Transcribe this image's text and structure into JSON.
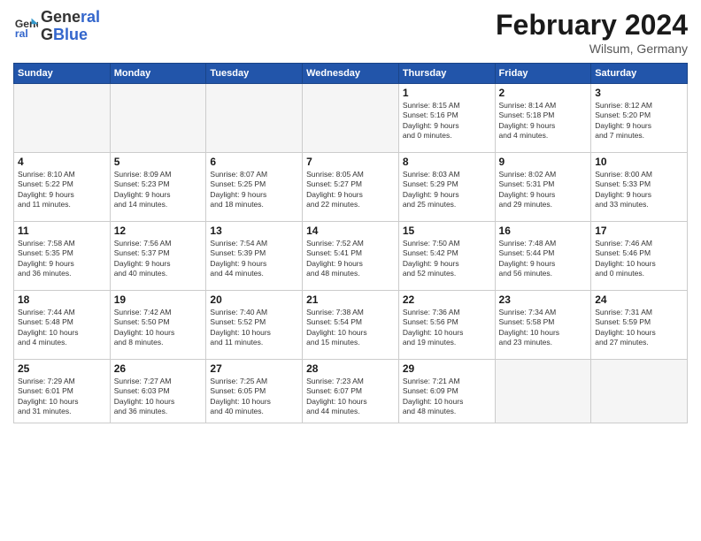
{
  "header": {
    "logo_line1": "General",
    "logo_line2": "Blue",
    "month_title": "February 2024",
    "location": "Wilsum, Germany"
  },
  "days_of_week": [
    "Sunday",
    "Monday",
    "Tuesday",
    "Wednesday",
    "Thursday",
    "Friday",
    "Saturday"
  ],
  "weeks": [
    [
      {
        "day": "",
        "info": ""
      },
      {
        "day": "",
        "info": ""
      },
      {
        "day": "",
        "info": ""
      },
      {
        "day": "",
        "info": ""
      },
      {
        "day": "1",
        "info": "Sunrise: 8:15 AM\nSunset: 5:16 PM\nDaylight: 9 hours\nand 0 minutes."
      },
      {
        "day": "2",
        "info": "Sunrise: 8:14 AM\nSunset: 5:18 PM\nDaylight: 9 hours\nand 4 minutes."
      },
      {
        "day": "3",
        "info": "Sunrise: 8:12 AM\nSunset: 5:20 PM\nDaylight: 9 hours\nand 7 minutes."
      }
    ],
    [
      {
        "day": "4",
        "info": "Sunrise: 8:10 AM\nSunset: 5:22 PM\nDaylight: 9 hours\nand 11 minutes."
      },
      {
        "day": "5",
        "info": "Sunrise: 8:09 AM\nSunset: 5:23 PM\nDaylight: 9 hours\nand 14 minutes."
      },
      {
        "day": "6",
        "info": "Sunrise: 8:07 AM\nSunset: 5:25 PM\nDaylight: 9 hours\nand 18 minutes."
      },
      {
        "day": "7",
        "info": "Sunrise: 8:05 AM\nSunset: 5:27 PM\nDaylight: 9 hours\nand 22 minutes."
      },
      {
        "day": "8",
        "info": "Sunrise: 8:03 AM\nSunset: 5:29 PM\nDaylight: 9 hours\nand 25 minutes."
      },
      {
        "day": "9",
        "info": "Sunrise: 8:02 AM\nSunset: 5:31 PM\nDaylight: 9 hours\nand 29 minutes."
      },
      {
        "day": "10",
        "info": "Sunrise: 8:00 AM\nSunset: 5:33 PM\nDaylight: 9 hours\nand 33 minutes."
      }
    ],
    [
      {
        "day": "11",
        "info": "Sunrise: 7:58 AM\nSunset: 5:35 PM\nDaylight: 9 hours\nand 36 minutes."
      },
      {
        "day": "12",
        "info": "Sunrise: 7:56 AM\nSunset: 5:37 PM\nDaylight: 9 hours\nand 40 minutes."
      },
      {
        "day": "13",
        "info": "Sunrise: 7:54 AM\nSunset: 5:39 PM\nDaylight: 9 hours\nand 44 minutes."
      },
      {
        "day": "14",
        "info": "Sunrise: 7:52 AM\nSunset: 5:41 PM\nDaylight: 9 hours\nand 48 minutes."
      },
      {
        "day": "15",
        "info": "Sunrise: 7:50 AM\nSunset: 5:42 PM\nDaylight: 9 hours\nand 52 minutes."
      },
      {
        "day": "16",
        "info": "Sunrise: 7:48 AM\nSunset: 5:44 PM\nDaylight: 9 hours\nand 56 minutes."
      },
      {
        "day": "17",
        "info": "Sunrise: 7:46 AM\nSunset: 5:46 PM\nDaylight: 10 hours\nand 0 minutes."
      }
    ],
    [
      {
        "day": "18",
        "info": "Sunrise: 7:44 AM\nSunset: 5:48 PM\nDaylight: 10 hours\nand 4 minutes."
      },
      {
        "day": "19",
        "info": "Sunrise: 7:42 AM\nSunset: 5:50 PM\nDaylight: 10 hours\nand 8 minutes."
      },
      {
        "day": "20",
        "info": "Sunrise: 7:40 AM\nSunset: 5:52 PM\nDaylight: 10 hours\nand 11 minutes."
      },
      {
        "day": "21",
        "info": "Sunrise: 7:38 AM\nSunset: 5:54 PM\nDaylight: 10 hours\nand 15 minutes."
      },
      {
        "day": "22",
        "info": "Sunrise: 7:36 AM\nSunset: 5:56 PM\nDaylight: 10 hours\nand 19 minutes."
      },
      {
        "day": "23",
        "info": "Sunrise: 7:34 AM\nSunset: 5:58 PM\nDaylight: 10 hours\nand 23 minutes."
      },
      {
        "day": "24",
        "info": "Sunrise: 7:31 AM\nSunset: 5:59 PM\nDaylight: 10 hours\nand 27 minutes."
      }
    ],
    [
      {
        "day": "25",
        "info": "Sunrise: 7:29 AM\nSunset: 6:01 PM\nDaylight: 10 hours\nand 31 minutes."
      },
      {
        "day": "26",
        "info": "Sunrise: 7:27 AM\nSunset: 6:03 PM\nDaylight: 10 hours\nand 36 minutes."
      },
      {
        "day": "27",
        "info": "Sunrise: 7:25 AM\nSunset: 6:05 PM\nDaylight: 10 hours\nand 40 minutes."
      },
      {
        "day": "28",
        "info": "Sunrise: 7:23 AM\nSunset: 6:07 PM\nDaylight: 10 hours\nand 44 minutes."
      },
      {
        "day": "29",
        "info": "Sunrise: 7:21 AM\nSunset: 6:09 PM\nDaylight: 10 hours\nand 48 minutes."
      },
      {
        "day": "",
        "info": ""
      },
      {
        "day": "",
        "info": ""
      }
    ]
  ]
}
